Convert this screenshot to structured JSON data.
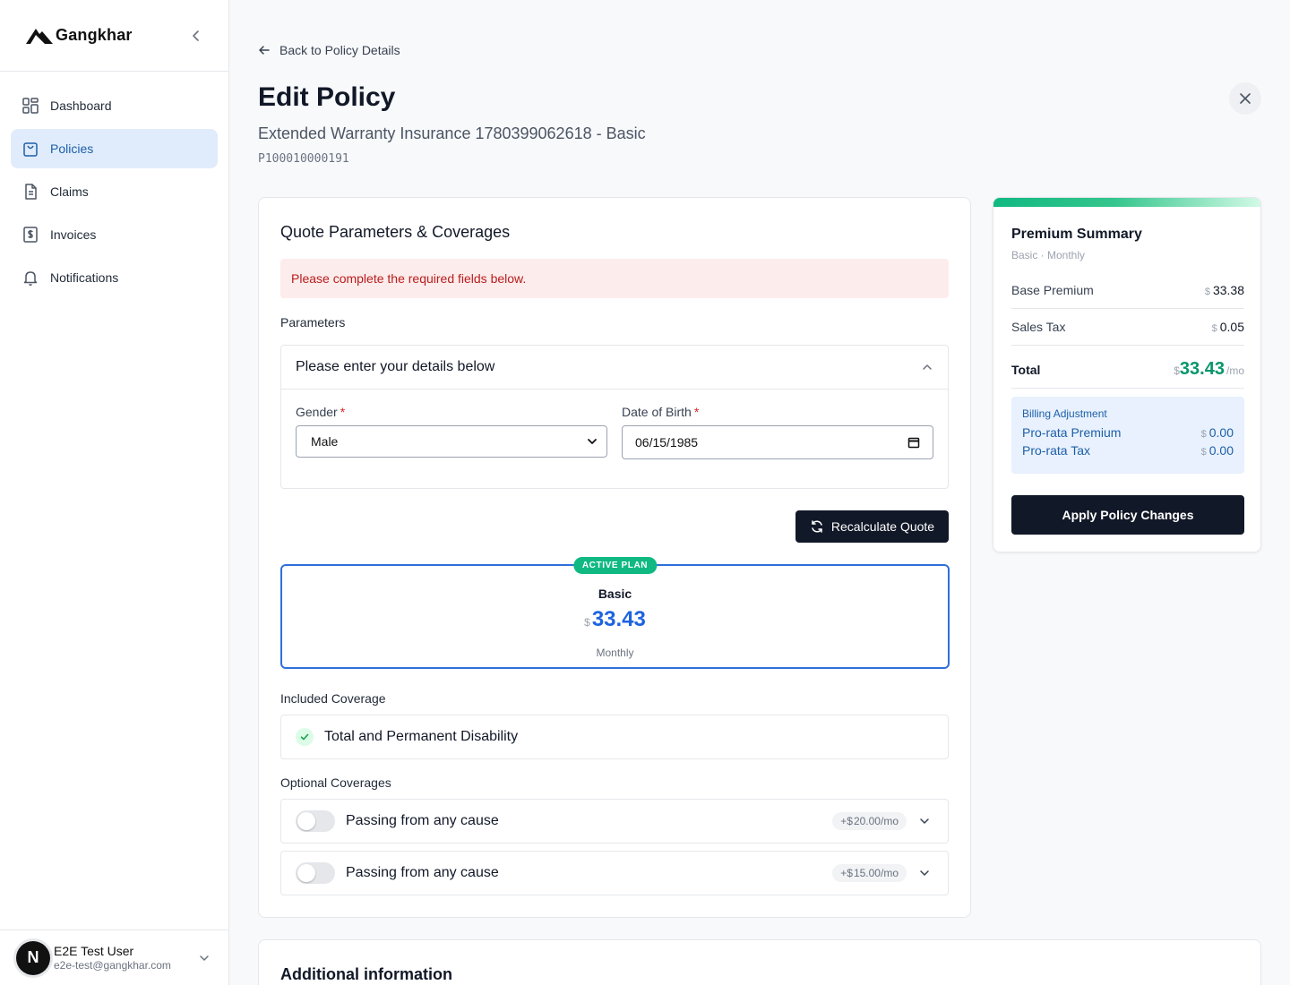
{
  "brand": {
    "name": "Gangkhar"
  },
  "sidebar": {
    "items": [
      {
        "label": "Dashboard",
        "icon": "dashboard-icon",
        "active": false
      },
      {
        "label": "Policies",
        "icon": "shopping-bag-icon",
        "active": true
      },
      {
        "label": "Claims",
        "icon": "document-icon",
        "active": false
      },
      {
        "label": "Invoices",
        "icon": "dollar-receipt-icon",
        "active": false
      },
      {
        "label": "Notifications",
        "icon": "bell-icon",
        "active": false
      }
    ]
  },
  "user": {
    "initial": "N",
    "name": "E2E Test User",
    "email": "e2e-test@gangkhar.com"
  },
  "header": {
    "back_label": "Back to Policy Details",
    "title": "Edit Policy",
    "subtitle": "Extended Warranty Insurance 1780399062618 - Basic",
    "policy_number": "P100010000191"
  },
  "quote": {
    "section_title": "Quote Parameters & Coverages",
    "alert": "Please complete the required fields below.",
    "parameters_label": "Parameters",
    "details_header": "Please enter your details below",
    "gender_label": "Gender",
    "gender_value": "Male",
    "dob_label": "Date of Birth",
    "dob_value": "06/15/1985",
    "required_mark": "*",
    "recalculate_label": "Recalculate Quote"
  },
  "plan": {
    "badge": "ACTIVE PLAN",
    "name": "Basic",
    "currency": "$",
    "price": "33.43",
    "frequency": "Monthly"
  },
  "coverage": {
    "included_label": "Included Coverage",
    "included_item": "Total and Permanent Disability",
    "optional_label": "Optional Coverages",
    "optional": [
      {
        "label": "Passing from any cause",
        "price_prefix": "+$",
        "price": "20.00",
        "unit": "/mo",
        "enabled": false
      },
      {
        "label": "Passing from any cause",
        "price_prefix": "+$",
        "price": "15.00",
        "unit": "/mo",
        "enabled": false
      }
    ]
  },
  "summary": {
    "title": "Premium Summary",
    "subtitle": "Basic · Monthly",
    "currency": "$",
    "base_label": "Base Premium",
    "base_value": "33.38",
    "tax_label": "Sales Tax",
    "tax_value": "0.05",
    "total_label": "Total",
    "total_value": "33.43",
    "total_unit": "/mo",
    "billing_title": "Billing Adjustment",
    "prorata_premium_label": "Pro-rata Premium",
    "prorata_premium_value": "0.00",
    "prorata_tax_label": "Pro-rata Tax",
    "prorata_tax_value": "0.00",
    "apply_label": "Apply Policy Changes"
  },
  "additional": {
    "title": "Additional information"
  },
  "colors": {
    "accent_blue": "#2f6fdb",
    "success_green": "#10b981",
    "primary_dark": "#111827",
    "error_red": "#b91c1c"
  }
}
